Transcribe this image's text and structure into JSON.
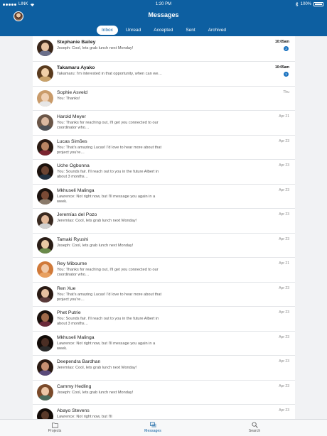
{
  "status_bar": {
    "carrier": "LINK",
    "time": "1:20 PM",
    "battery": "100%"
  },
  "header": {
    "title": "Messages"
  },
  "tabs": [
    {
      "label": "Inbox",
      "active": true
    },
    {
      "label": "Unread",
      "active": false
    },
    {
      "label": "Accepted",
      "active": false
    },
    {
      "label": "Sent",
      "active": false
    },
    {
      "label": "Archived",
      "active": false
    }
  ],
  "messages": [
    {
      "name": "Stephanie Bailey",
      "preview": "Joseph: Cool, lets grab lunch next Monday!",
      "time": "10:05am",
      "unread": true,
      "badge": "2",
      "skin": "#e8c2a0",
      "hair": "#3a2619",
      "shirt": "#6b6f8a"
    },
    {
      "name": "Takamaru Ayako",
      "preview": "Takamaru: I'm interested in that opportunity, when can we…",
      "time": "10:05am",
      "unread": true,
      "badge": "1",
      "skin": "#f0cfa8",
      "hair": "#5a3b1e",
      "shirt": "#c9a26a"
    },
    {
      "name": "Sophie Asveld",
      "preview": "You: Thanks!",
      "time": "Thu",
      "unread": false,
      "badge": "",
      "skin": "#efd0b4",
      "hair": "#c99b6a",
      "shirt": "#e6e6e6"
    },
    {
      "name": "Harold Meyer",
      "preview": "You: Thanks for reaching out, I'll get you connected to our coordinator who…",
      "time": "Apr 21",
      "unread": false,
      "badge": "",
      "skin": "#d9b8a0",
      "hair": "#6a5648",
      "shirt": "#4b4f55"
    },
    {
      "name": "Lucas Simões",
      "preview": "You: That's amazing Lucas! I'd love to hear more about that project you're…",
      "time": "Apr 23",
      "unread": false,
      "badge": "",
      "skin": "#b98563",
      "hair": "#2a1a12",
      "shirt": "#7a2430"
    },
    {
      "name": "Uche Ogbonna",
      "preview": "You: Sounds fair. I'll reach out to you in the future Albert in about 3 months…",
      "time": "Apr 23",
      "unread": false,
      "badge": "",
      "skin": "#6b4432",
      "hair": "#1c120d",
      "shirt": "#203040"
    },
    {
      "name": "Mkhuseli Malinga",
      "preview": "Lawrence: Not right now, but I'll message you again in a week.",
      "time": "Apr 23",
      "unread": false,
      "badge": "",
      "skin": "#7a4a35",
      "hair": "#1b120e",
      "shirt": "#8a7a6a"
    },
    {
      "name": "Jeremías del Pozo",
      "preview": "Jeremías: Cool, lets grab lunch next Monday!",
      "time": "Apr 23",
      "unread": false,
      "badge": "",
      "skin": "#e2b99a",
      "hair": "#3a2a20",
      "shirt": "#cfcfcf"
    },
    {
      "name": "Tamaki Ryushi",
      "preview": "Joseph: Cool, lets grab lunch next Monday!",
      "time": "Apr 23",
      "unread": false,
      "badge": "",
      "skin": "#e8c9a4",
      "hair": "#2a1d16",
      "shirt": "#6a8a4a"
    },
    {
      "name": "Rey Mibourne",
      "preview": "You: Thanks for reaching out, I'll get you connected to our coordinator who…",
      "time": "Apr 21",
      "unread": false,
      "badge": "",
      "skin": "#f0c9a8",
      "hair": "#d07a3a",
      "shirt": "#e8a060"
    },
    {
      "name": "Ren Xue",
      "preview": "You: That's amazing Lucas! I'd love to hear more about that project you're…",
      "time": "Apr 23",
      "unread": false,
      "badge": "",
      "skin": "#e6c0a0",
      "hair": "#2a1a14",
      "shirt": "#5a3a3a"
    },
    {
      "name": "Phet Putrie",
      "preview": "You: Sounds fair. I'll reach out to you in the future Albert in about 3 months…",
      "time": "Apr 23",
      "unread": false,
      "badge": "",
      "skin": "#a06a4a",
      "hair": "#1a100c",
      "shirt": "#6a2a3a"
    },
    {
      "name": "Mkhuseli Malinga",
      "preview": "Lawrence: Not right now, but I'll message you again in a week.",
      "time": "Apr 23",
      "unread": false,
      "badge": "",
      "skin": "#4a2e24",
      "hair": "#120b08",
      "shirt": "#2a2a2a"
    },
    {
      "name": "Deependra Bardhan",
      "preview": "Jeremías: Cool, lets grab lunch next Monday!",
      "time": "Apr 23",
      "unread": false,
      "badge": "",
      "skin": "#c69072",
      "hair": "#2a1a12",
      "shirt": "#5a4a7a"
    },
    {
      "name": "Cammy Hedling",
      "preview": "Joseph: Cool, lets grab lunch next Monday!",
      "time": "Apr 23",
      "unread": false,
      "badge": "",
      "skin": "#ecc6a6",
      "hair": "#7a4a2a",
      "shirt": "#4a6a5a"
    },
    {
      "name": "Abayo Stevens",
      "preview": "Lawrence: Not right now, but I'll",
      "time": "Apr 23",
      "unread": false,
      "badge": "",
      "skin": "#5a3a2a",
      "hair": "#140c08",
      "shirt": "#3a3a4a"
    }
  ],
  "tabbar": [
    {
      "label": "Projects",
      "icon": "folder-icon",
      "active": false
    },
    {
      "label": "Messages",
      "icon": "messages-icon",
      "active": true
    },
    {
      "label": "Search",
      "icon": "search-icon",
      "active": false
    }
  ],
  "colors": {
    "brand": "#0d5fa1",
    "badge": "#1b73c0"
  }
}
